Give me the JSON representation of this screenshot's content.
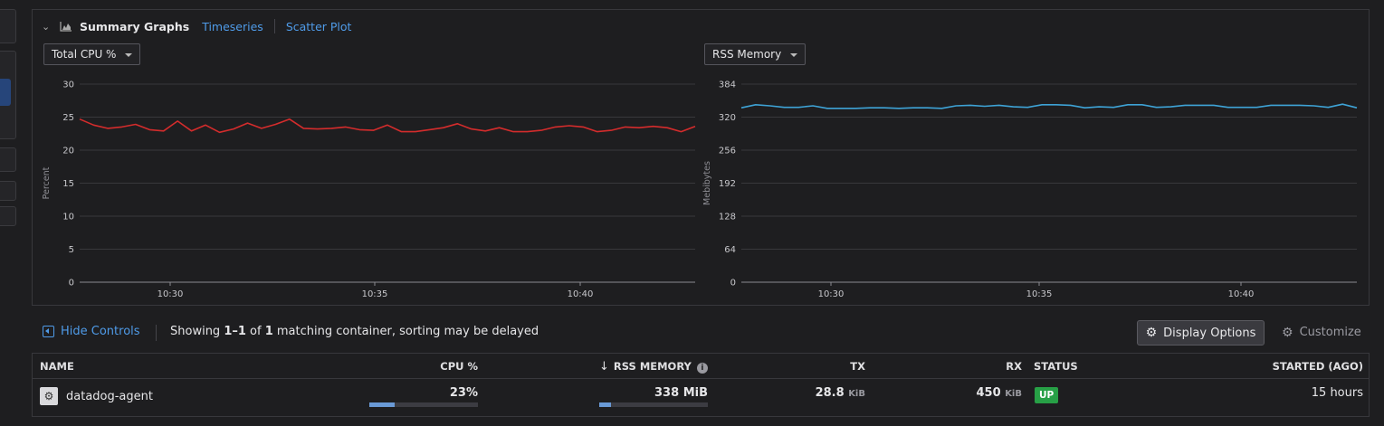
{
  "summary": {
    "title": "Summary Graphs",
    "tabs": [
      {
        "label": "Timeseries"
      },
      {
        "label": "Scatter Plot"
      }
    ],
    "icons": {
      "collapse": "chevron-down-icon",
      "graph": "area-chart-icon"
    }
  },
  "cpu_chart": {
    "selector_label": "Total CPU %",
    "ylabel": "Percent",
    "y_ticks": [
      "30",
      "25",
      "20",
      "15",
      "10",
      "5",
      "0"
    ],
    "x_ticks": [
      "10:30",
      "10:35",
      "10:40"
    ]
  },
  "rss_chart": {
    "selector_label": "RSS Memory",
    "ylabel": "Mebibytes",
    "y_ticks": [
      "384",
      "320",
      "256",
      "192",
      "128",
      "64",
      "0"
    ],
    "x_ticks": [
      "10:30",
      "10:35",
      "10:40"
    ]
  },
  "chart_data": [
    {
      "type": "line",
      "ylabel": "Percent",
      "ylim": [
        0,
        30
      ],
      "x_ticks": [
        "10:30",
        "10:35",
        "10:40"
      ],
      "series": [
        {
          "color": "#d42c2c",
          "values": [
            24.7,
            23.8,
            23.3,
            23.5,
            23.9,
            23.1,
            22.9,
            24.4,
            22.9,
            23.8,
            22.7,
            23.2,
            24.1,
            23.3,
            23.9,
            24.7,
            23.3,
            23.2,
            23.3,
            23.5,
            23.1,
            23.0,
            23.8,
            22.8,
            22.8,
            23.1,
            23.4,
            24.0,
            23.2,
            22.9,
            23.4,
            22.8,
            22.8,
            23.0,
            23.5,
            23.7,
            23.5,
            22.8,
            23.0,
            23.5,
            23.4,
            23.6,
            23.4,
            22.8,
            23.6
          ]
        }
      ],
      "grid": true
    },
    {
      "type": "line",
      "ylabel": "Mebibytes",
      "ylim": [
        0,
        384
      ],
      "x_ticks": [
        "10:30",
        "10:35",
        "10:40"
      ],
      "series": [
        {
          "color": "#3ea3d6",
          "values": [
            338,
            344,
            342,
            339,
            339,
            342,
            337,
            337,
            337,
            338,
            338,
            337,
            338,
            338,
            337,
            342,
            343,
            341,
            343,
            340,
            339,
            344,
            344,
            343,
            338,
            340,
            339,
            344,
            344,
            339,
            340,
            343,
            343,
            343,
            339,
            339,
            339,
            343,
            343,
            343,
            342,
            339,
            345,
            338
          ]
        }
      ],
      "grid": true
    }
  ],
  "controls": {
    "hide_label": "Hide Controls",
    "showing_prefix": "Showing ",
    "showing_range": "1–1",
    "showing_of": " of ",
    "showing_count": "1",
    "showing_suffix": " matching container, sorting may be delayed",
    "display_options": "Display Options",
    "customize": "Customize"
  },
  "table": {
    "columns": {
      "name": "NAME",
      "cpu": "CPU %",
      "sort_arrow": "↓",
      "rss": "RSS MEMORY",
      "tx": "TX",
      "rx": "RX",
      "status": "STATUS",
      "started": "STARTED (AGO)"
    },
    "rows": [
      {
        "name": "datadog-agent",
        "cpu": "23%",
        "cpu_fraction": 0.23,
        "rss_value": "338",
        "rss_unit": "MiB",
        "rss_fraction": 0.11,
        "tx_value": "28.8",
        "tx_unit": "KiB",
        "rx_value": "450",
        "rx_unit": "KiB",
        "status": "UP",
        "started": "15 hours"
      }
    ]
  },
  "colors": {
    "accent": "#4f9be8",
    "cpu_line": "#d42c2c",
    "rss_line": "#3ea3d6",
    "status_up": "#27a046"
  }
}
